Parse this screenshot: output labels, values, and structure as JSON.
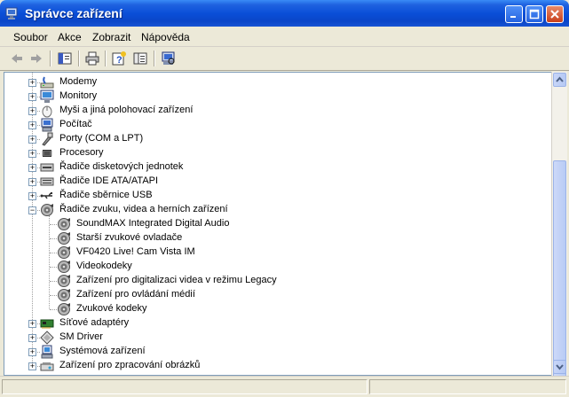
{
  "window": {
    "title": "Správce zařízení"
  },
  "menu": [
    "Soubor",
    "Akce",
    "Zobrazit",
    "Nápověda"
  ],
  "toolbar": [
    {
      "name": "back-icon"
    },
    {
      "name": "forward-icon"
    },
    {
      "name": "console-tree-icon"
    },
    {
      "name": "print-icon"
    },
    {
      "name": "help-icon"
    },
    {
      "name": "properties-icon"
    },
    {
      "name": "scan-hardware-icon"
    }
  ],
  "tree": [
    {
      "label": "Modemy",
      "level": 0,
      "expander": "+",
      "icon": "modem-icon"
    },
    {
      "label": "Monitory",
      "level": 0,
      "expander": "+",
      "icon": "monitor-icon"
    },
    {
      "label": "Myši a jiná polohovací zařízení",
      "level": 0,
      "expander": "+",
      "icon": "mouse-icon"
    },
    {
      "label": "Počítač",
      "level": 0,
      "expander": "+",
      "icon": "computer-icon"
    },
    {
      "label": "Porty (COM a LPT)",
      "level": 0,
      "expander": "+",
      "icon": "port-icon"
    },
    {
      "label": "Procesory",
      "level": 0,
      "expander": "+",
      "icon": "processor-icon"
    },
    {
      "label": "Řadiče disketových jednotek",
      "level": 0,
      "expander": "+",
      "icon": "floppy-controller-icon"
    },
    {
      "label": "Řadiče IDE ATA/ATAPI",
      "level": 0,
      "expander": "+",
      "icon": "ide-controller-icon"
    },
    {
      "label": "Řadiče sběrnice USB",
      "level": 0,
      "expander": "+",
      "icon": "usb-icon"
    },
    {
      "label": "Řadiče zvuku, videa a herních zařízení",
      "level": 0,
      "expander": "-",
      "icon": "sound-icon"
    },
    {
      "label": "SoundMAX Integrated Digital Audio",
      "level": 1,
      "icon": "sound-icon"
    },
    {
      "label": "Starší zvukové ovladače",
      "level": 1,
      "icon": "sound-icon"
    },
    {
      "label": "VF0420 Live! Cam Vista IM",
      "level": 1,
      "icon": "sound-icon"
    },
    {
      "label": "Videokodeky",
      "level": 1,
      "icon": "sound-icon"
    },
    {
      "label": "Zařízení pro digitalizaci videa v režimu Legacy",
      "level": 1,
      "icon": "sound-icon"
    },
    {
      "label": "Zařízení pro ovládání médií",
      "level": 1,
      "icon": "sound-icon"
    },
    {
      "label": "Zvukové kodeky",
      "level": 1,
      "icon": "sound-icon"
    },
    {
      "label": "Síťové adaptéry",
      "level": 0,
      "expander": "+",
      "icon": "network-adapter-icon"
    },
    {
      "label": "SM Driver",
      "level": 0,
      "expander": "+",
      "icon": "sm-driver-icon"
    },
    {
      "label": "Systémová zařízení",
      "level": 0,
      "expander": "+",
      "icon": "system-device-icon"
    },
    {
      "label": "Zařízení pro zpracování obrázků",
      "level": 0,
      "expander": "+",
      "icon": "imaging-device-icon"
    }
  ],
  "colors": {
    "title_blue": "#0a4fd8",
    "tree_lines": "#a0a0a0",
    "panel_border": "#7f9db9"
  }
}
